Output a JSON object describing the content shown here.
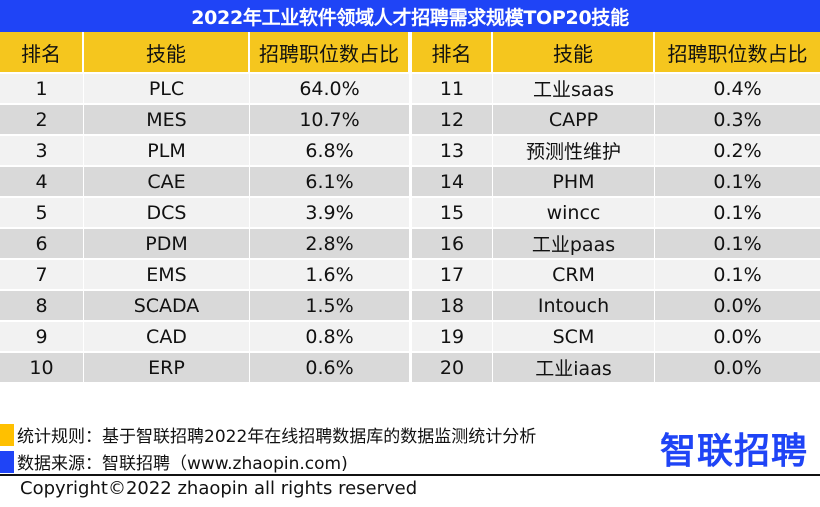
{
  "title": "2022年工业软件领域人才招聘需求规模TOP20技能",
  "colors": {
    "title_bg": "#1F44F6",
    "header_bg": "#F5C61E",
    "row_light": "#F2F2F2",
    "row_dark": "#D9D9D9",
    "legend_rule": "#FFC000",
    "legend_source": "#1F44F6"
  },
  "headers": [
    "排名",
    "技能",
    "招聘职位数占比",
    "排名",
    "技能",
    "招聘职位数占比"
  ],
  "left_rows": [
    {
      "rank": "1",
      "skill": "PLC",
      "share": "64.0%"
    },
    {
      "rank": "2",
      "skill": "MES",
      "share": "10.7%"
    },
    {
      "rank": "3",
      "skill": "PLM",
      "share": "6.8%"
    },
    {
      "rank": "4",
      "skill": "CAE",
      "share": "6.1%"
    },
    {
      "rank": "5",
      "skill": "DCS",
      "share": "3.9%"
    },
    {
      "rank": "6",
      "skill": "PDM",
      "share": "2.8%"
    },
    {
      "rank": "7",
      "skill": "EMS",
      "share": "1.6%"
    },
    {
      "rank": "8",
      "skill": "SCADA",
      "share": "1.5%"
    },
    {
      "rank": "9",
      "skill": "CAD",
      "share": "0.8%"
    },
    {
      "rank": "10",
      "skill": "ERP",
      "share": "0.6%"
    }
  ],
  "right_rows": [
    {
      "rank": "11",
      "skill": "工业saas",
      "share": "0.4%"
    },
    {
      "rank": "12",
      "skill": "CAPP",
      "share": "0.3%"
    },
    {
      "rank": "13",
      "skill": "预测性维护",
      "share": "0.2%"
    },
    {
      "rank": "14",
      "skill": "PHM",
      "share": "0.1%"
    },
    {
      "rank": "15",
      "skill": "wincc",
      "share": "0.1%"
    },
    {
      "rank": "16",
      "skill": "工业paas",
      "share": "0.1%"
    },
    {
      "rank": "17",
      "skill": "CRM",
      "share": "0.1%"
    },
    {
      "rank": "18",
      "skill": "Intouch",
      "share": "0.0%"
    },
    {
      "rank": "19",
      "skill": "SCM",
      "share": "0.0%"
    },
    {
      "rank": "20",
      "skill": "工业iaas",
      "share": "0.0%"
    }
  ],
  "footer": {
    "rule": "统计规则：基于智联招聘2022年在线招聘数据库的数据监测统计分析",
    "source": "数据来源：智联招聘（www.zhaopin.com)",
    "logo": "智联招聘",
    "copyright": "Copyright©2022 zhaopin all rights reserved"
  }
}
